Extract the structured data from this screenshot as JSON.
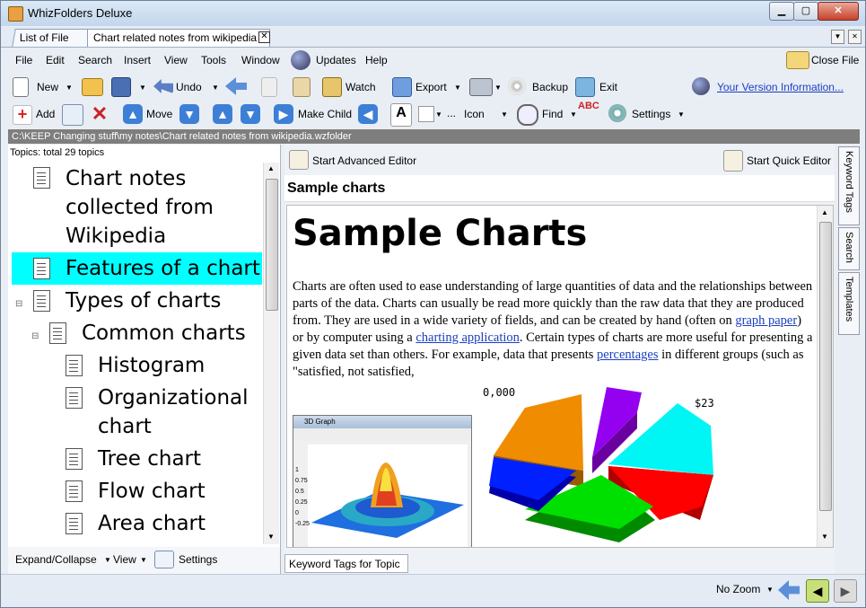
{
  "window": {
    "title": "WhizFolders Deluxe"
  },
  "tabs": [
    {
      "label": "List of File"
    },
    {
      "label": "Chart related notes from wikipedia"
    }
  ],
  "menu": [
    "File",
    "Edit",
    "Search",
    "Insert",
    "View",
    "Tools",
    "Window",
    "Updates",
    "Help"
  ],
  "close_file": "Close File",
  "toolbar": {
    "new": "New",
    "undo": "Undo",
    "watch": "Watch",
    "export": "Export",
    "backup": "Backup",
    "exit": "Exit",
    "version_link": "Your Version Information...",
    "add": "Add",
    "move": "Move",
    "make_child": "Make Child",
    "icon": "Icon",
    "find": "Find",
    "settings": "Settings",
    "ellipsis": "..."
  },
  "path": "C:\\KEEP Changing stuff\\my notes\\Chart related notes from wikipedia.wzfolder",
  "topics": {
    "count": "Topics: total 29 topics",
    "items": [
      {
        "label": "Chart notes collected from Wikipedia",
        "lines": [
          "Chart notes",
          "collected from",
          "Wikipedia"
        ]
      },
      {
        "label": "Features of a chart"
      },
      {
        "label": "Types of charts"
      },
      {
        "label": "Common charts"
      },
      {
        "label": "Histogram"
      },
      {
        "label": "Organizational chart",
        "lines": [
          "Organizational",
          "chart"
        ]
      },
      {
        "label": "Tree chart"
      },
      {
        "label": "Flow chart"
      },
      {
        "label": "Area chart"
      }
    ]
  },
  "left_footer": {
    "expand": "Expand/Collapse",
    "view": "View",
    "settings": "Settings"
  },
  "editor": {
    "advanced": "Start Advanced Editor",
    "quick": "Start Quick Editor",
    "note_title": "Sample charts",
    "heading": "Sample Charts",
    "text_1": "Charts are often used to ease understanding of large quantities of data and the relationships between parts of the data. Charts can usually be read more quickly than the raw data that they are produced from. They are used in a wide variety of fields, and can be created by hand (often on ",
    "link_1": "graph paper",
    "text_2": ") or by computer using a ",
    "link_2": "charting application",
    "text_3": ". Certain types of charts are more useful for presenting a given data set than others. For example, data that presents ",
    "link_3": "percentages",
    "text_4": " in different groups (such as \"satisfied, not satisfied,",
    "graph_window_title": "3D Graph",
    "graph_yticks": [
      "1",
      "0.75",
      "0.5",
      "0.25",
      "0",
      "-0.25"
    ],
    "pie_label_1": "0,000",
    "pie_label_2": "$23"
  },
  "right_tabs": [
    "Keyword Tags",
    "Search",
    "Templates"
  ],
  "keyword_tab": "Keyword Tags for Topic",
  "status": {
    "zoom": "No Zoom"
  },
  "colors": {
    "selected": "#00ffff",
    "link": "#1a3fbf"
  }
}
